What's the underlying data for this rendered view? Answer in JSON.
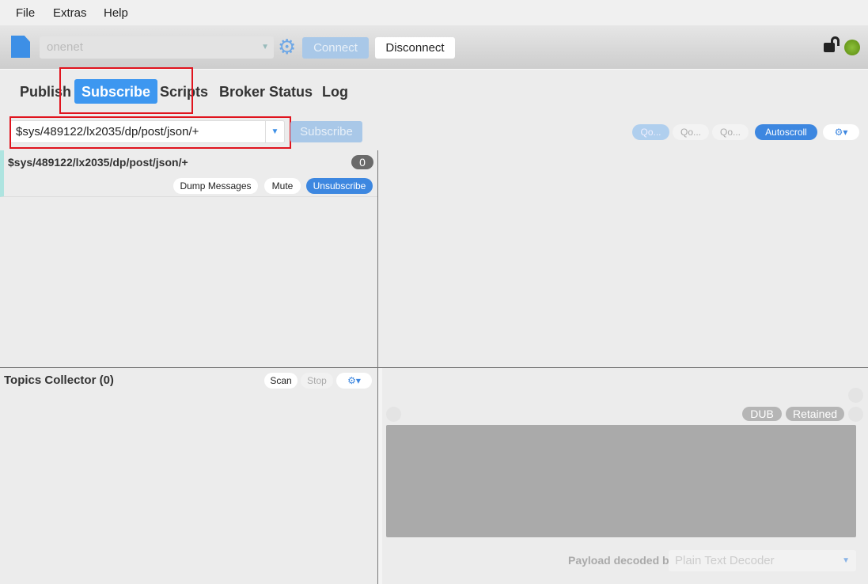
{
  "menu": [
    "File",
    "Extras",
    "Help"
  ],
  "toolbar": {
    "profile": "onenet",
    "connect": "Connect",
    "disconnect": "Disconnect",
    "status_color": "#6a9e1a"
  },
  "tabs": [
    "Publish",
    "Subscribe",
    "Scripts",
    "Broker Status",
    "Log"
  ],
  "active_tab": "Subscribe",
  "subscribe": {
    "topic": "$sys/489122/lx2035/dp/post/json/+",
    "button": "Subscribe"
  },
  "right_controls": {
    "qos": [
      "Qo...",
      "Qo...",
      "Qo..."
    ],
    "autoscroll": "Autoscroll"
  },
  "subscription": {
    "topic": "$sys/489122/lx2035/dp/post/json/+",
    "count": "0",
    "dump": "Dump Messages",
    "mute": "Mute",
    "unsubscribe": "Unsubscribe"
  },
  "collector": {
    "title": "Topics Collector (0)",
    "scan": "Scan",
    "stop": "Stop"
  },
  "detail": {
    "dub": "DUB",
    "retained": "Retained",
    "decoded_label": "Payload decoded by",
    "decoder": "Plain Text Decoder"
  },
  "colors": {
    "accent": "#3d97f0",
    "highlight": "#e0141e"
  }
}
